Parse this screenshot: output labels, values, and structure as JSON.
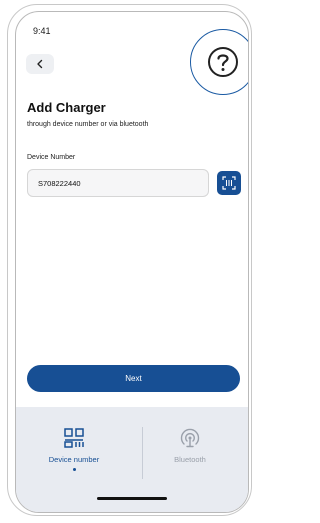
{
  "status_bar": {
    "time": "9:41"
  },
  "header": {
    "back_icon": "chevron-left-icon",
    "help_icon": "question-circle-icon"
  },
  "page": {
    "title": "Add Charger",
    "subtitle": "through device number or via bluetooth"
  },
  "form": {
    "device_number_label": "Device Number",
    "device_number_value": "S708222440",
    "scan_icon": "scan-qr-icon"
  },
  "actions": {
    "next_label": "Next"
  },
  "bottom_tabs": {
    "items": [
      {
        "label": "Device number",
        "icon": "qr-code-icon",
        "selected": true
      },
      {
        "label": "Bluetooth",
        "icon": "bluetooth-signal-icon",
        "selected": false
      }
    ]
  },
  "colors": {
    "primary": "#174f94",
    "tab_bar_bg": "#e8ebf1",
    "inactive": "#9aa0aa"
  }
}
